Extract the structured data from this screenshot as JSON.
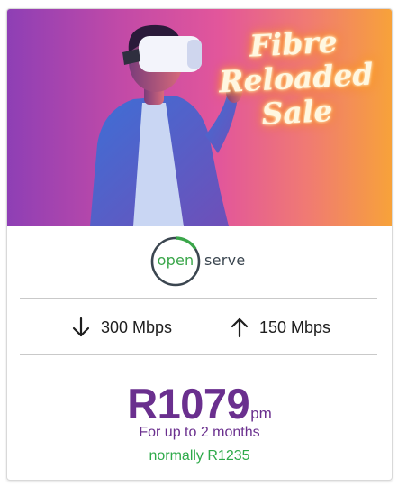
{
  "promo": {
    "headline_lines": [
      "Fibre",
      "Reloaded",
      "Sale"
    ]
  },
  "provider": {
    "logo_left": "open",
    "logo_right": "serve",
    "logo_colors": {
      "open": "#3aa64a",
      "serve": "#3b4650"
    }
  },
  "speeds": {
    "download": "300 Mbps",
    "upload": "150 Mbps",
    "download_icon": "arrow-down-icon",
    "upload_icon": "arrow-up-icon"
  },
  "pricing": {
    "amount": "R1079",
    "unit": "pm",
    "period": "For up to 2 months",
    "normal_price": "normally R1235",
    "colors": {
      "price": "#6a2f8e",
      "normal": "#2eaa4a"
    }
  },
  "colors": {
    "hero_gradient": [
      "#8e3fb5",
      "#e2569b",
      "#f7a23a"
    ],
    "neon_text": "#fff7e0"
  }
}
